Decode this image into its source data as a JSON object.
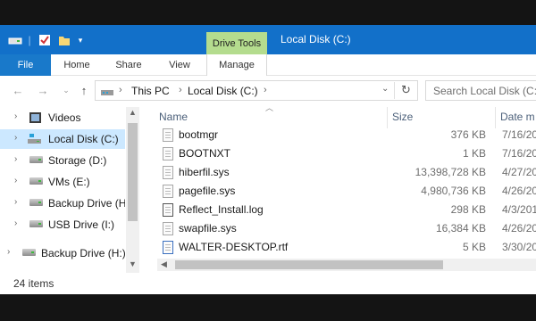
{
  "window": {
    "title": "Local Disk (C:)",
    "contextual_tab": "Drive Tools",
    "accent": "#1270c9",
    "contextual_color": "#b4dc8e"
  },
  "ribbon": {
    "tabs": [
      {
        "label": "File"
      },
      {
        "label": "Home"
      },
      {
        "label": "Share"
      },
      {
        "label": "View"
      },
      {
        "label": "Manage"
      }
    ]
  },
  "address": {
    "crumbs": [
      "This PC",
      "Local Disk (C:)"
    ]
  },
  "search": {
    "placeholder": "Search Local Disk (C:)"
  },
  "nav": {
    "items": [
      {
        "label": "Videos",
        "icon": "video-folder-icon"
      },
      {
        "label": "Local Disk (C:)",
        "icon": "system-drive-icon",
        "selected": true
      },
      {
        "label": "Storage (D:)",
        "icon": "drive-icon"
      },
      {
        "label": "VMs (E:)",
        "icon": "drive-icon"
      },
      {
        "label": "Backup Drive (H",
        "icon": "drive-icon"
      },
      {
        "label": "USB Drive (I:)",
        "icon": "drive-icon"
      },
      {
        "label": "Backup Drive (H:)",
        "icon": "drive-icon"
      }
    ]
  },
  "list": {
    "columns": {
      "name": "Name",
      "size": "Size",
      "date": "Date m"
    },
    "files": [
      {
        "name": "bootmgr",
        "size": "376 KB",
        "date": "7/16/20"
      },
      {
        "name": "BOOTNXT",
        "size": "1 KB",
        "date": "7/16/20"
      },
      {
        "name": "hiberfil.sys",
        "size": "13,398,728 KB",
        "date": "4/27/20"
      },
      {
        "name": "pagefile.sys",
        "size": "4,980,736 KB",
        "date": "4/26/20"
      },
      {
        "name": "Reflect_Install.log",
        "size": "298 KB",
        "date": "4/3/201"
      },
      {
        "name": "swapfile.sys",
        "size": "16,384 KB",
        "date": "4/26/20"
      },
      {
        "name": "WALTER-DESKTOP.rtf",
        "size": "5 KB",
        "date": "3/30/20"
      }
    ]
  },
  "status": {
    "item_count": "24 items"
  }
}
